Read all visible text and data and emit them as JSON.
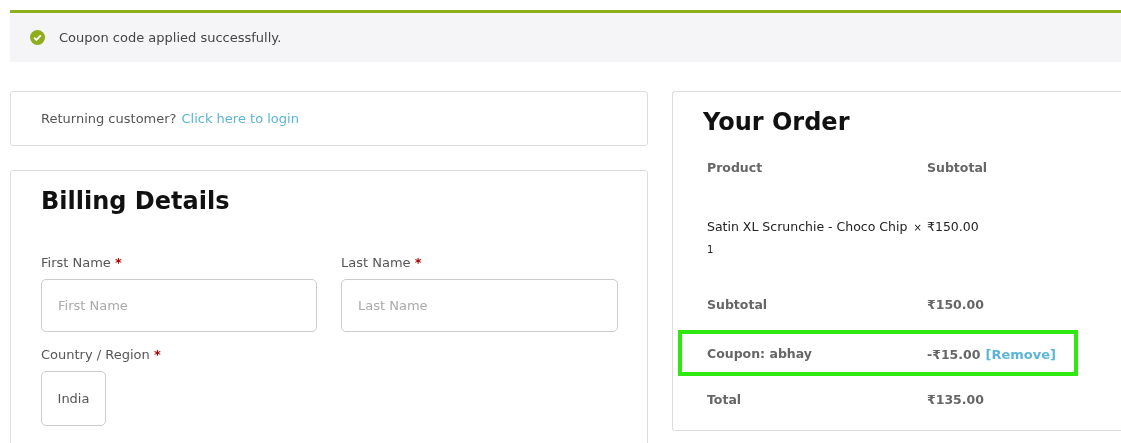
{
  "notice": {
    "text": "Coupon code applied successfully."
  },
  "login": {
    "prompt": "Returning customer?",
    "link": "Click here to login"
  },
  "billing": {
    "title": "Billing Details",
    "fields": [
      {
        "label": "First Name",
        "required": "*",
        "placeholder": "First Name"
      },
      {
        "label": "Last Name",
        "required": "*",
        "placeholder": "Last Name"
      }
    ],
    "country": {
      "label": "Country / Region",
      "required": "*",
      "value": "India"
    }
  },
  "order": {
    "title": "Your Order",
    "columns": [
      "Product",
      "Subtotal"
    ],
    "rows": [
      {
        "kind": "item",
        "name": "Satin XL Scrunchie - Choco Chip",
        "qty": "× 1",
        "amount": "₹150.00",
        "highlighted": false
      },
      {
        "kind": "total",
        "name": "Subtotal",
        "amount": "₹150.00",
        "highlighted": false
      },
      {
        "kind": "coupon",
        "name": "Coupon: abhay",
        "amount": "-₹15.00",
        "action": "[Remove]",
        "highlighted": true
      },
      {
        "kind": "total",
        "name": "Total",
        "amount": "₹135.00",
        "highlighted": false
      }
    ]
  }
}
